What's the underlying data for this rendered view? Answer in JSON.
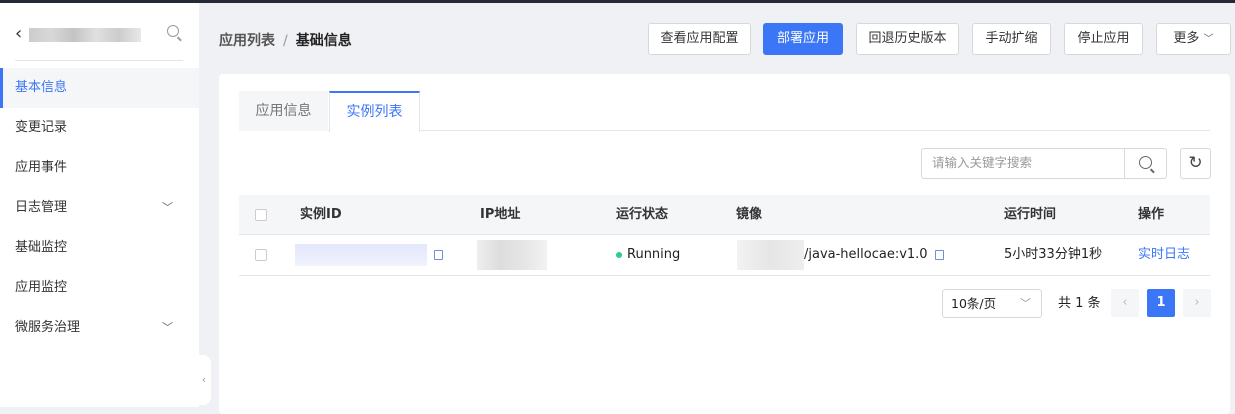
{
  "sidebar": {
    "items": [
      {
        "label": "基本信息",
        "active": true
      },
      {
        "label": "变更记录"
      },
      {
        "label": "应用事件"
      },
      {
        "label": "日志管理",
        "expandable": true
      },
      {
        "label": "基础监控"
      },
      {
        "label": "应用监控"
      },
      {
        "label": "微服务治理",
        "expandable": true
      }
    ]
  },
  "breadcrumb": {
    "parent": "应用列表",
    "separator": "/",
    "current": "基础信息"
  },
  "toolbar": {
    "view_config": "查看应用配置",
    "deploy": "部署应用",
    "rollback": "回退历史版本",
    "scale": "手动扩缩",
    "stop": "停止应用",
    "more": "更多"
  },
  "tabs": [
    {
      "label": "应用信息"
    },
    {
      "label": "实例列表",
      "active": true
    }
  ],
  "search": {
    "placeholder": "请输入关键字搜索",
    "value": ""
  },
  "table": {
    "headers": [
      "实例ID",
      "IP地址",
      "运行状态",
      "镜像",
      "运行时间",
      "操作"
    ],
    "rows": [
      {
        "status": "Running",
        "image_suffix": "/java-hellocae:v1.0",
        "uptime": "5小时33分钟1秒",
        "action": "实时日志"
      }
    ]
  },
  "pagination": {
    "page_size": "10条/页",
    "total": "共 1 条",
    "current": "1"
  },
  "colors": {
    "accent": "#3b76f6",
    "running": "#2ecc8a"
  }
}
